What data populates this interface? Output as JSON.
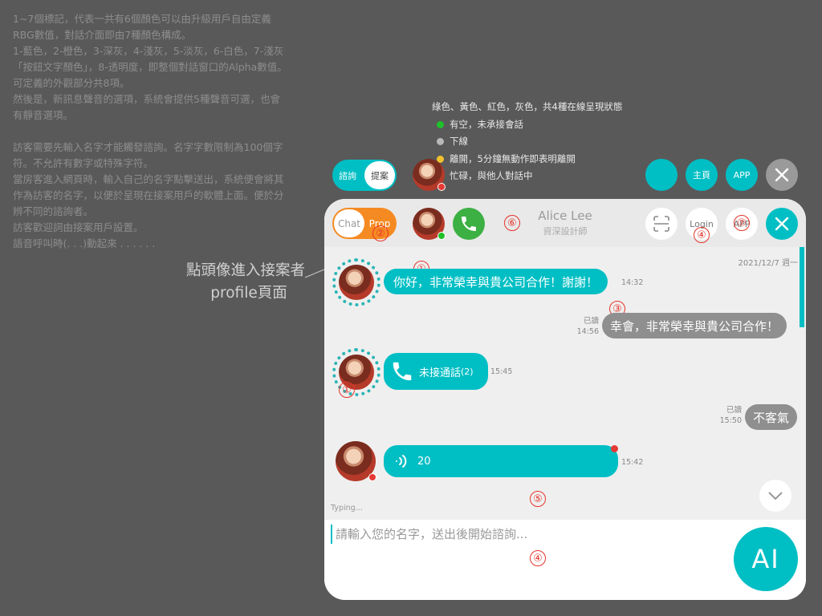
{
  "notes": [
    "1~7個標記，代表一共有6個顏色可以由升級用戶自由定義RBG數值，對話介面即由7種顏色構成。",
    "1-藍色，2-橙色，3-深灰，4-淺灰，5-淡灰，6-白色，7-淺灰「按鈕文字顏色」，8-透明度，即整個對話窗口的Alpha數值。可定義的外觀部分共8項。",
    "然後是，新訊息聲音的選項，系統會提供5種聲音可選，也會有靜音選項。",
    "",
    "訪客需要先輸入名字才能觸發諮詢。名字字數限制為100個字符。不允許有數字或特殊字符。",
    "當房客進入網頁時，輸入自己的名字點擊送出，系統便會將其作為訪客的名字，以便於呈現在接案用戶的軟體上面。便於分辨不同的諮詢者。",
    "訪客歡迎詞由接案用戶設置。",
    "語音呼叫時(. . .)動起來 .  . .   . . ."
  ],
  "legend": {
    "title": "綠色、黃色、紅色，灰色，共4種在線呈現狀態",
    "items": [
      {
        "label": "有空，未承接會話",
        "color": "#1fc02a"
      },
      {
        "label": "下線",
        "color": "#b8b8b8"
      },
      {
        "label": "離開，5分鐘無動作即表明離開",
        "color": "#f2c12e"
      },
      {
        "label": "忙碌，與他人對話中",
        "color": "#e53935"
      }
    ]
  },
  "callout": {
    "line1": "點頭像進入接案者",
    "line2": "profile頁面"
  },
  "preview": {
    "toggle_a": "諮詢",
    "toggle_b": "提案",
    "home_label": "主頁",
    "app_label": "APP"
  },
  "header": {
    "toggle_chat": "Chat",
    "toggle_prop": "Prop",
    "agent_name": "Alice Lee",
    "agent_title": "資深設計師",
    "login_label": "Login",
    "app_label": "APP"
  },
  "markers": {
    "m1": "①",
    "m2": "②",
    "m3": "③",
    "m4": "④",
    "m5": "⑤",
    "m6": "⑥",
    "m7": "⑦"
  },
  "chat": {
    "date": "2021/12/7 週一",
    "msg1": {
      "text": "你好，非常榮幸與貴公司合作！謝謝！",
      "time": "14:32"
    },
    "msg2": {
      "text": "幸會，非常榮幸與貴公司合作！",
      "read": "已讀",
      "time": "14:56"
    },
    "msg3": {
      "text": "未接通話",
      "count": "(2)",
      "time": "15:45"
    },
    "msg4": {
      "text": "不客氣",
      "read": "已讀",
      "time": "15:50"
    },
    "msg5": {
      "text": "20",
      "time": "15:42"
    },
    "typing": "Typing..."
  },
  "input": {
    "placeholder": "請輸入您的名字，送出後開始諮詢...",
    "value": ""
  },
  "ai_label": "AI",
  "colors": {
    "accent": "#00bfc4",
    "orange": "#f58a22",
    "green": "#3cb043",
    "gray_bubble": "#8f8f8f"
  }
}
